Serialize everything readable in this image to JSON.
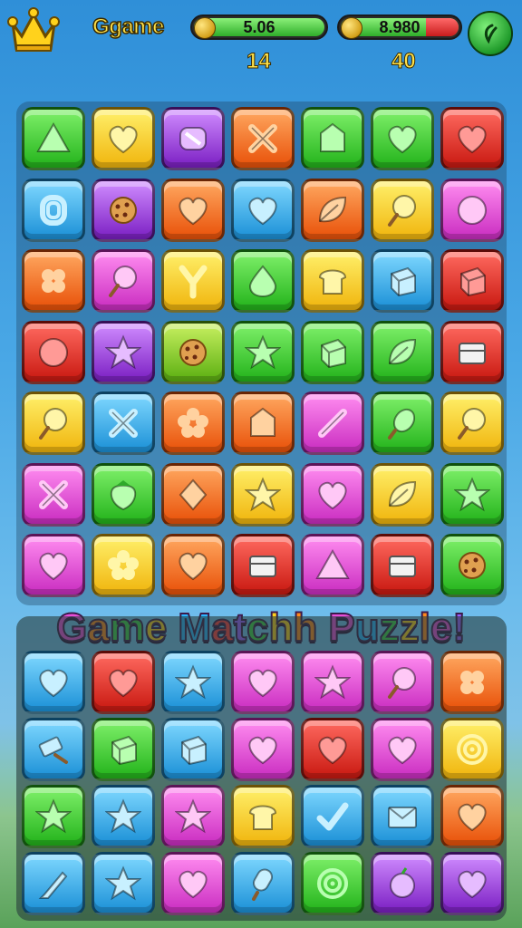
{
  "header": {
    "game_name": "Ggame",
    "bar1_value": "5.06",
    "bar2_value": "8.980",
    "count1": "14",
    "count2": "40",
    "icons": {
      "crown": "crown-icon",
      "coin": "coin-icon",
      "settings": "leaf-icon"
    }
  },
  "banner": {
    "text": "Game Matchh Puzzle!",
    "colors": [
      "#e94fd9",
      "#ff8a1c",
      "#3fd04a",
      "#ffd21c",
      "#2bb5ff",
      "#ff3d3d",
      "#9a5cff",
      "#3fd04a",
      "#ffd21c",
      "#ff8a1c",
      "#e94fd9",
      "#2bb5ff",
      "#3fd04a",
      "#ffd21c",
      "#ff8a1c",
      "#e94fd9",
      "#9a5cff",
      "#3fd04a",
      "#ff3d3d"
    ]
  },
  "colors": {
    "green": "#3ccf2e",
    "yellow": "#ffd21c",
    "pink": "#e94fd9",
    "orange": "#ff6a1c",
    "red": "#e8261f",
    "blue": "#2ab0ef",
    "purple": "#a23ee0",
    "lime": "#7ad61e"
  },
  "grid": [
    [
      [
        "green",
        "triangle"
      ],
      [
        "yellow",
        "heart"
      ],
      [
        "purple",
        "candy"
      ],
      [
        "orange",
        "cross"
      ],
      [
        "green",
        "house"
      ],
      [
        "green",
        "heart"
      ],
      [
        "red",
        "heart"
      ]
    ],
    [
      [
        "blue",
        "clip"
      ],
      [
        "purple",
        "cookie"
      ],
      [
        "orange",
        "heart"
      ],
      [
        "blue",
        "heart"
      ],
      [
        "orange",
        "leaf"
      ],
      [
        "yellow",
        "lollipop"
      ],
      [
        "pink",
        "circle"
      ]
    ],
    [
      [
        "orange",
        "clover"
      ],
      [
        "pink",
        "lollipop"
      ],
      [
        "yellow",
        "ycandy"
      ],
      [
        "green",
        "drop"
      ],
      [
        "yellow",
        "bread"
      ],
      [
        "blue",
        "cube"
      ],
      [
        "red",
        "cube"
      ]
    ],
    [
      [
        "red",
        "circle"
      ],
      [
        "purple",
        "star"
      ],
      [
        "lime",
        "cookie"
      ],
      [
        "green",
        "star"
      ],
      [
        "green",
        "cube"
      ],
      [
        "green",
        "leaf"
      ],
      [
        "red",
        "box"
      ]
    ],
    [
      [
        "yellow",
        "lollipop"
      ],
      [
        "blue",
        "cross"
      ],
      [
        "orange",
        "flower"
      ],
      [
        "orange",
        "house"
      ],
      [
        "pink",
        "wand"
      ],
      [
        "green",
        "corn"
      ],
      [
        "yellow",
        "lollipop"
      ]
    ],
    [
      [
        "pink",
        "cross"
      ],
      [
        "green",
        "strawberry"
      ],
      [
        "orange",
        "diamond"
      ],
      [
        "yellow",
        "star"
      ],
      [
        "pink",
        "heart"
      ],
      [
        "yellow",
        "leaf"
      ],
      [
        "green",
        "star"
      ]
    ],
    [
      [
        "pink",
        "heart"
      ],
      [
        "yellow",
        "flower"
      ],
      [
        "orange",
        "heart"
      ],
      [
        "red",
        "box"
      ],
      [
        "pink",
        "triangle"
      ],
      [
        "red",
        "box"
      ],
      [
        "green",
        "cookie"
      ]
    ]
  ],
  "grid2": [
    [
      [
        "blue",
        "heart"
      ],
      [
        "red",
        "heart"
      ],
      [
        "blue",
        "star"
      ],
      [
        "pink",
        "heart"
      ],
      [
        "pink",
        "star"
      ],
      [
        "pink",
        "lollipop"
      ],
      [
        "orange",
        "clover"
      ]
    ],
    [
      [
        "blue",
        "brush"
      ],
      [
        "green",
        "cube"
      ],
      [
        "blue",
        "cube"
      ],
      [
        "pink",
        "heart"
      ],
      [
        "red",
        "heart"
      ],
      [
        "pink",
        "heart"
      ],
      [
        "yellow",
        "target"
      ]
    ],
    [
      [
        "green",
        "star"
      ],
      [
        "blue",
        "star"
      ],
      [
        "pink",
        "star"
      ],
      [
        "yellow",
        "bread"
      ],
      [
        "blue",
        "check"
      ],
      [
        "blue",
        "envelope"
      ],
      [
        "orange",
        "heart"
      ]
    ],
    [
      [
        "blue",
        "pencil"
      ],
      [
        "blue",
        "star"
      ],
      [
        "pink",
        "heart"
      ],
      [
        "blue",
        "popsicle"
      ],
      [
        "green",
        "target"
      ],
      [
        "purple",
        "apple"
      ],
      [
        "purple",
        "heart"
      ]
    ]
  ]
}
